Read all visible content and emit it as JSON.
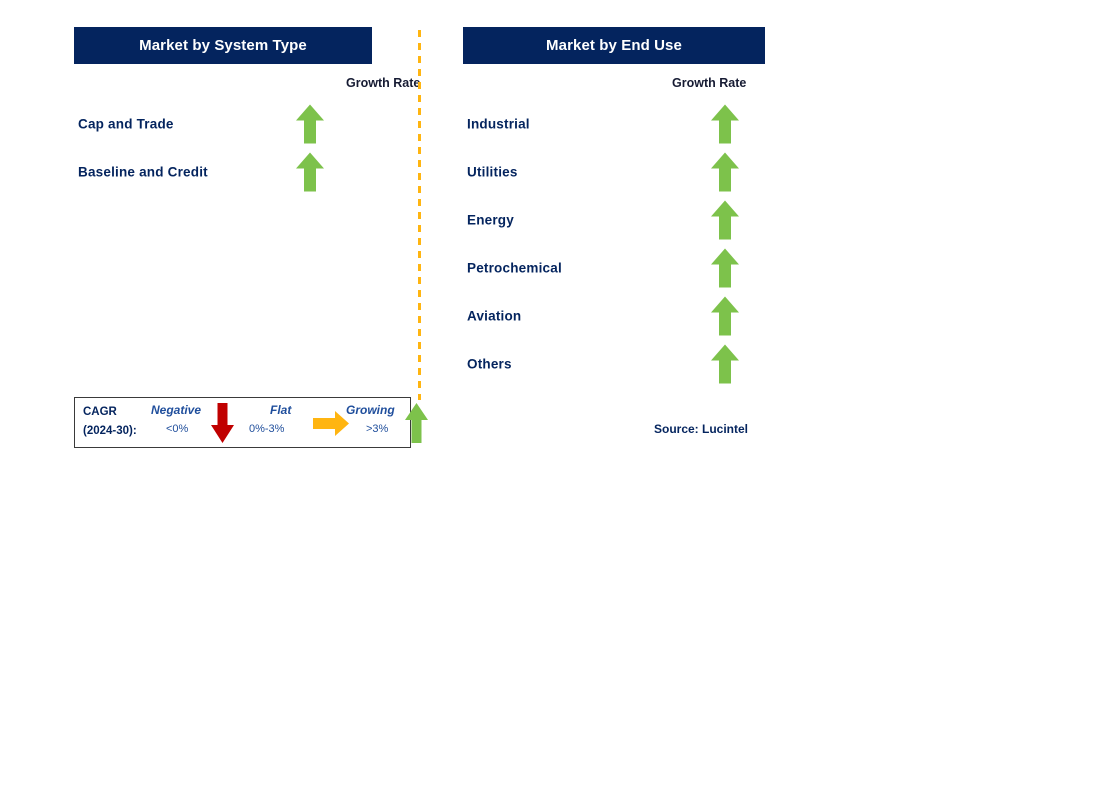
{
  "chart_data": {
    "type": "table",
    "title": "Market Segment Growth Rate Overview",
    "legend_position": "bottom-left",
    "panels": [
      {
        "title": "Market by System Type",
        "column_header": "Growth Rate",
        "rows": [
          {
            "label": "Cap and Trade",
            "growth": "Growing",
            "cagr_band": ">3%",
            "icon": "up-arrow-icon"
          },
          {
            "label": "Baseline and Credit",
            "growth": "Growing",
            "cagr_band": ">3%",
            "icon": "up-arrow-icon"
          }
        ]
      },
      {
        "title": "Market by End Use",
        "column_header": "Growth Rate",
        "rows": [
          {
            "label": "Industrial",
            "growth": "Growing",
            "cagr_band": ">3%",
            "icon": "up-arrow-icon"
          },
          {
            "label": "Utilities",
            "growth": "Growing",
            "cagr_band": ">3%",
            "icon": "up-arrow-icon"
          },
          {
            "label": "Energy",
            "growth": "Growing",
            "cagr_band": ">3%",
            "icon": "up-arrow-icon"
          },
          {
            "label": "Petrochemical",
            "growth": "Growing",
            "cagr_band": ">3%",
            "icon": "up-arrow-icon"
          },
          {
            "label": "Aviation",
            "growth": "Growing",
            "cagr_band": ">3%",
            "icon": "up-arrow-icon"
          },
          {
            "label": "Others",
            "growth": "Growing",
            "cagr_band": ">3%",
            "icon": "up-arrow-icon"
          }
        ]
      }
    ]
  },
  "panels": {
    "system_type": {
      "title": "Market by System Type",
      "growth_rate_label": "Growth Rate",
      "items": [
        {
          "label": "Cap and Trade"
        },
        {
          "label": "Baseline and Credit"
        }
      ]
    },
    "end_use": {
      "title": "Market by End Use",
      "growth_rate_label": "Growth Rate",
      "items": [
        {
          "label": "Industrial"
        },
        {
          "label": "Utilities"
        },
        {
          "label": "Energy"
        },
        {
          "label": "Petrochemical"
        },
        {
          "label": "Aviation"
        },
        {
          "label": "Others"
        }
      ]
    }
  },
  "legend": {
    "cagr_line1": "CAGR",
    "cagr_line2": "(2024-30):",
    "items": [
      {
        "term": "Negative",
        "range": "<0%",
        "icon": "down-arrow-icon",
        "color": "#C00000"
      },
      {
        "term": "Flat",
        "range": "0%-3%",
        "icon": "right-arrow-icon",
        "color": "#FFB511"
      },
      {
        "term": "Growing",
        "range": ">3%",
        "icon": "up-arrow-icon",
        "color": "#7DC24B"
      }
    ]
  },
  "source": "Source: Lucintel",
  "colors": {
    "header_navy": "#04245E",
    "label_navy": "#04245E",
    "growing_green": "#7DC24B",
    "negative_red": "#C00000",
    "flat_orange": "#FFB511",
    "divider_orange": "#FFB511"
  }
}
